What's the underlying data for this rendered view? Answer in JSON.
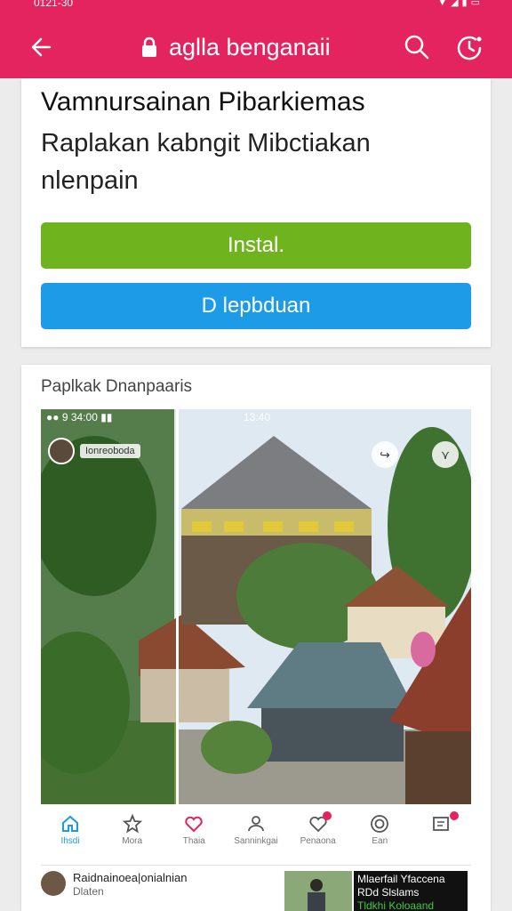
{
  "status_bar": {
    "time": "0121-30"
  },
  "header": {
    "title": "aglla benganaii"
  },
  "card": {
    "headline": "Vamnursainan Pibarkiemas",
    "subtitle": "Raplakan kabngit Mibctiakan nlenpain",
    "install_label": "Instal.",
    "download_label": "D lepbduan"
  },
  "preview": {
    "label": "Paplkak Dnanpaaris",
    "left_status": "●● 9 34:00 ▮▮",
    "right_status": "13:40",
    "user_chip": "Ionreoboda"
  },
  "tabs": [
    {
      "label": "Ihsdi"
    },
    {
      "label": "Mora"
    },
    {
      "label": "Thaia"
    },
    {
      "label": "Sanninkgai"
    },
    {
      "label": "Penaona"
    },
    {
      "label": "Ean"
    },
    {
      "label": ""
    }
  ],
  "list_item": {
    "title": "Raidnainoea|onialnian",
    "subtitle": "Dlaten",
    "promo_line1": "Mlaerfail Yfaccena",
    "promo_line2": "RDd Slslams",
    "promo_line3": "Tldkhi Koloaand"
  },
  "colors": {
    "header_bg": "#e3245f",
    "install_bg": "#6fb31f",
    "download_bg": "#1e9be6"
  },
  "icons": {
    "back": "arrow-left-icon",
    "lock": "lock-icon",
    "search": "search-icon",
    "history": "clock-icon"
  }
}
